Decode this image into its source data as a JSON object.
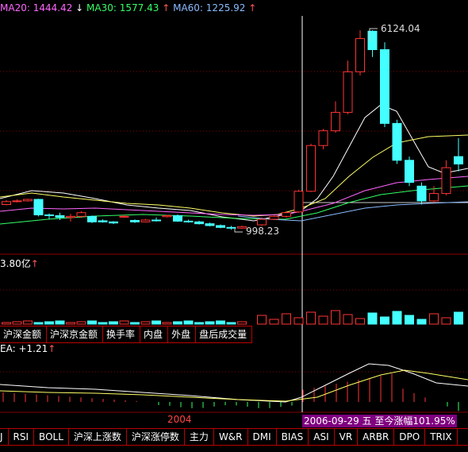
{
  "legend": {
    "ma20_label": "MA20:",
    "ma20_value": "1444.42",
    "ma20_arrow": "↓",
    "ma30_label": "MA30:",
    "ma30_value": "1577.43",
    "ma30_arrow": "↑",
    "ma60_label": "MA60:",
    "ma60_value": "1225.92",
    "ma60_arrow": "↑"
  },
  "price_annotations": {
    "high": "6124.04",
    "low": "998.23"
  },
  "volume": {
    "label": "3.80亿",
    "arrow": "↑"
  },
  "mid_tabs": [
    "沪深金额",
    "沪深京金额",
    "换手率",
    "内盘",
    "外盘",
    "盘后成交量"
  ],
  "macd": {
    "label": "EA: +1.21",
    "arrow": "↑"
  },
  "axis": {
    "year": "2004",
    "date_tip": "2006-09-29 五 至今涨幅101.95%"
  },
  "bottom_tabs": [
    "J",
    "RSI",
    "BOLL",
    "沪深上涨数",
    "沪深涨停数",
    "主力",
    "W&R",
    "DMI",
    "BIAS",
    "ASI",
    "VR",
    "ARBR",
    "DPO",
    "TRIX"
  ],
  "colors": {
    "up": "#ff3333",
    "down": "#44ffff",
    "ma_white": "#ffffff",
    "ma_yellow": "#ffff66",
    "ma_magenta": "#ff66ff",
    "ma_green": "#33ff66",
    "ma_blue": "#88bbff",
    "grid": "#880000"
  },
  "chart_data": {
    "type": "candlestick",
    "candles": [
      {
        "o": 1400,
        "c": 1480,
        "h": 1520,
        "l": 1380
      },
      {
        "o": 1480,
        "c": 1500,
        "h": 1540,
        "l": 1460
      },
      {
        "o": 1500,
        "c": 1540,
        "h": 1560,
        "l": 1480
      },
      {
        "o": 1540,
        "c": 1120,
        "h": 1560,
        "l": 1080
      },
      {
        "o": 1120,
        "c": 1110,
        "h": 1160,
        "l": 1000
      },
      {
        "o": 1100,
        "c": 1050,
        "h": 1180,
        "l": 980
      },
      {
        "o": 1050,
        "c": 1080,
        "h": 1150,
        "l": 940
      },
      {
        "o": 1080,
        "c": 1180,
        "h": 1220,
        "l": 1040
      },
      {
        "o": 1080,
        "c": 930,
        "h": 1100,
        "l": 900
      },
      {
        "o": 960,
        "c": 930,
        "h": 1000,
        "l": 910
      },
      {
        "o": 930,
        "c": 900,
        "h": 950,
        "l": 870
      },
      {
        "o": 1070,
        "c": 1080,
        "h": 1130,
        "l": 1040
      },
      {
        "o": 970,
        "c": 930,
        "h": 1000,
        "l": 900
      },
      {
        "o": 930,
        "c": 980,
        "h": 1010,
        "l": 920
      },
      {
        "o": 980,
        "c": 960,
        "h": 1050,
        "l": 940
      },
      {
        "o": 1070,
        "c": 1100,
        "h": 1120,
        "l": 1050
      },
      {
        "o": 1100,
        "c": 950,
        "h": 1130,
        "l": 930
      },
      {
        "o": 950,
        "c": 930,
        "h": 990,
        "l": 910
      },
      {
        "o": 930,
        "c": 880,
        "h": 960,
        "l": 860
      },
      {
        "o": 880,
        "c": 830,
        "h": 910,
        "l": 810
      },
      {
        "o": 830,
        "c": 780,
        "h": 860,
        "l": 760
      },
      {
        "o": 780,
        "c": 760,
        "h": 820,
        "l": 720
      },
      {
        "o": 760,
        "c": 800,
        "h": 830,
        "l": 740
      },
      {
        "o": 850,
        "c": 1000,
        "h": 1050,
        "l": 820
      },
      {
        "o": 1000,
        "c": 1080,
        "h": 1120,
        "l": 980
      },
      {
        "o": 1080,
        "c": 1180,
        "h": 1220,
        "l": 1040
      },
      {
        "o": 1200,
        "c": 1760,
        "h": 1800,
        "l": 1180
      },
      {
        "o": 1760,
        "c": 3000,
        "h": 3050,
        "l": 1740
      },
      {
        "o": 3000,
        "c": 3400,
        "h": 3450,
        "l": 2900
      },
      {
        "o": 3400,
        "c": 3900,
        "h": 4200,
        "l": 3350
      },
      {
        "o": 3900,
        "c": 5000,
        "h": 5300,
        "l": 3850
      },
      {
        "o": 5000,
        "c": 5900,
        "h": 6124,
        "l": 4900
      },
      {
        "o": 6100,
        "c": 5600,
        "h": 6124,
        "l": 5400
      },
      {
        "o": 5600,
        "c": 3600,
        "h": 5800,
        "l": 3500
      },
      {
        "o": 3600,
        "c": 2600,
        "h": 3700,
        "l": 2500
      },
      {
        "o": 2600,
        "c": 2000,
        "h": 2700,
        "l": 1900
      },
      {
        "o": 1900,
        "c": 1500,
        "h": 2000,
        "l": 1400
      },
      {
        "o": 1500,
        "c": 1700,
        "h": 1900,
        "l": 1450
      },
      {
        "o": 1700,
        "c": 2400,
        "h": 2600,
        "l": 1650
      },
      {
        "o": 2700,
        "c": 2500,
        "h": 3200,
        "l": 2300
      }
    ]
  }
}
